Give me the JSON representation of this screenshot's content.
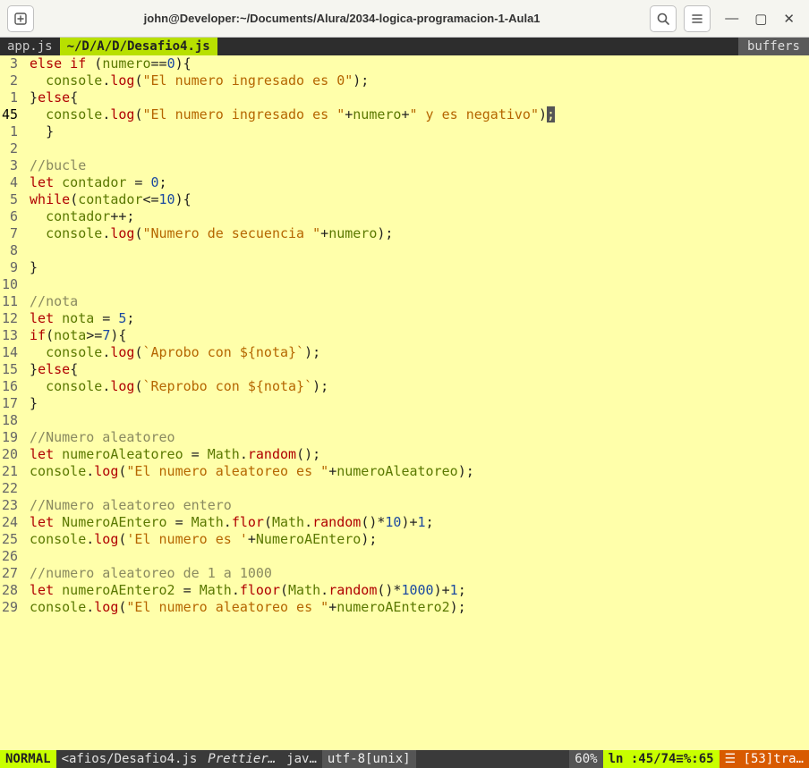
{
  "titlebar": {
    "title": "john@Developer:~/Documents/Alura/2034-logica-programacion-1-Aula1"
  },
  "tabbar": {
    "tabs": [
      {
        "label": "app.js",
        "active": false
      },
      {
        "label": "~/D/A/D/Desafio4.js",
        "active": true
      }
    ],
    "buffers_label": "buffers"
  },
  "code": {
    "lines": [
      {
        "g": "3",
        "cur": false,
        "tokens": [
          [
            "kw-red",
            "else if"
          ],
          [
            "punct",
            " ("
          ],
          [
            "var-gr",
            "numero"
          ],
          [
            "punct",
            "=="
          ],
          [
            "num-bl",
            "0"
          ],
          [
            "punct",
            "){"
          ]
        ]
      },
      {
        "g": "2",
        "cur": false,
        "tokens": [
          [
            "punct",
            "  "
          ],
          [
            "var-gr",
            "console"
          ],
          [
            "punct",
            "."
          ],
          [
            "fn-red",
            "log"
          ],
          [
            "punct",
            "("
          ],
          [
            "str-og",
            "\"El numero ingresado es 0\""
          ],
          [
            "punct",
            ");"
          ]
        ]
      },
      {
        "g": "1",
        "cur": false,
        "tokens": [
          [
            "punct",
            "}"
          ],
          [
            "kw-red",
            "else"
          ],
          [
            "punct",
            "{"
          ]
        ]
      },
      {
        "g": "45",
        "cur": true,
        "tokens": [
          [
            "punct",
            "  "
          ],
          [
            "var-gr",
            "console"
          ],
          [
            "punct",
            "."
          ],
          [
            "fn-red",
            "log"
          ],
          [
            "punct",
            "("
          ],
          [
            "str-og",
            "\"El numero ingresado es \""
          ],
          [
            "punct",
            "+"
          ],
          [
            "var-gr",
            "numero"
          ],
          [
            "punct",
            "+"
          ],
          [
            "str-og",
            "\" y es negativo\""
          ],
          [
            "punct",
            ")"
          ],
          [
            "cursor",
            ";"
          ]
        ]
      },
      {
        "g": "1",
        "cur": false,
        "tokens": [
          [
            "punct",
            "  }"
          ]
        ]
      },
      {
        "g": "2",
        "cur": false,
        "tokens": []
      },
      {
        "g": "3",
        "cur": false,
        "tokens": [
          [
            "cmt-gr",
            "//bucle "
          ]
        ]
      },
      {
        "g": "4",
        "cur": false,
        "tokens": [
          [
            "kw-red",
            "let"
          ],
          [
            "punct",
            " "
          ],
          [
            "var-gr",
            "contador"
          ],
          [
            "punct",
            " = "
          ],
          [
            "num-bl",
            "0"
          ],
          [
            "punct",
            ";"
          ]
        ]
      },
      {
        "g": "5",
        "cur": false,
        "tokens": [
          [
            "kw-red",
            "while"
          ],
          [
            "punct",
            "("
          ],
          [
            "var-gr",
            "contador"
          ],
          [
            "punct",
            "<="
          ],
          [
            "num-bl",
            "10"
          ],
          [
            "punct",
            "){"
          ]
        ]
      },
      {
        "g": "6",
        "cur": false,
        "tokens": [
          [
            "punct",
            "  "
          ],
          [
            "var-gr",
            "contador"
          ],
          [
            "punct",
            "++;"
          ]
        ]
      },
      {
        "g": "7",
        "cur": false,
        "tokens": [
          [
            "punct",
            "  "
          ],
          [
            "var-gr",
            "console"
          ],
          [
            "punct",
            "."
          ],
          [
            "fn-red",
            "log"
          ],
          [
            "punct",
            "("
          ],
          [
            "str-og",
            "\"Numero de secuencia \""
          ],
          [
            "punct",
            "+"
          ],
          [
            "var-gr",
            "numero"
          ],
          [
            "punct",
            ");"
          ]
        ]
      },
      {
        "g": "8",
        "cur": false,
        "tokens": []
      },
      {
        "g": "9",
        "cur": false,
        "tokens": [
          [
            "punct",
            "}"
          ]
        ]
      },
      {
        "g": "10",
        "cur": false,
        "tokens": []
      },
      {
        "g": "11",
        "cur": false,
        "tokens": [
          [
            "cmt-gr",
            "//nota"
          ]
        ]
      },
      {
        "g": "12",
        "cur": false,
        "tokens": [
          [
            "kw-red",
            "let"
          ],
          [
            "punct",
            " "
          ],
          [
            "var-gr",
            "nota"
          ],
          [
            "punct",
            " = "
          ],
          [
            "num-bl",
            "5"
          ],
          [
            "punct",
            ";"
          ]
        ]
      },
      {
        "g": "13",
        "cur": false,
        "tokens": [
          [
            "kw-red",
            "if"
          ],
          [
            "punct",
            "("
          ],
          [
            "var-gr",
            "nota"
          ],
          [
            "punct",
            ">="
          ],
          [
            "num-bl",
            "7"
          ],
          [
            "punct",
            "){"
          ]
        ]
      },
      {
        "g": "14",
        "cur": false,
        "tokens": [
          [
            "punct",
            "  "
          ],
          [
            "var-gr",
            "console"
          ],
          [
            "punct",
            "."
          ],
          [
            "fn-red",
            "log"
          ],
          [
            "punct",
            "("
          ],
          [
            "str-og",
            "`Aprobo con ${nota}`"
          ],
          [
            "punct",
            ");"
          ]
        ]
      },
      {
        "g": "15",
        "cur": false,
        "tokens": [
          [
            "punct",
            "}"
          ],
          [
            "kw-red",
            "else"
          ],
          [
            "punct",
            "{"
          ]
        ]
      },
      {
        "g": "16",
        "cur": false,
        "tokens": [
          [
            "punct",
            "  "
          ],
          [
            "var-gr",
            "console"
          ],
          [
            "punct",
            "."
          ],
          [
            "fn-red",
            "log"
          ],
          [
            "punct",
            "("
          ],
          [
            "str-og",
            "`Reprobo con ${nota}`"
          ],
          [
            "punct",
            ");"
          ]
        ]
      },
      {
        "g": "17",
        "cur": false,
        "tokens": [
          [
            "punct",
            "}"
          ]
        ]
      },
      {
        "g": "18",
        "cur": false,
        "tokens": []
      },
      {
        "g": "19",
        "cur": false,
        "tokens": [
          [
            "cmt-gr",
            "//Numero aleatoreo"
          ]
        ]
      },
      {
        "g": "20",
        "cur": false,
        "tokens": [
          [
            "kw-red",
            "let"
          ],
          [
            "punct",
            " "
          ],
          [
            "var-gr",
            "numeroAleatoreo"
          ],
          [
            "punct",
            " = "
          ],
          [
            "var-gr",
            "Math"
          ],
          [
            "punct",
            "."
          ],
          [
            "fn-red",
            "random"
          ],
          [
            "punct",
            "();"
          ]
        ]
      },
      {
        "g": "21",
        "cur": false,
        "tokens": [
          [
            "var-gr",
            "console"
          ],
          [
            "punct",
            "."
          ],
          [
            "fn-red",
            "log"
          ],
          [
            "punct",
            "("
          ],
          [
            "str-og",
            "\"El numero aleatoreo es \""
          ],
          [
            "punct",
            "+"
          ],
          [
            "var-gr",
            "numeroAleatoreo"
          ],
          [
            "punct",
            ");"
          ]
        ]
      },
      {
        "g": "22",
        "cur": false,
        "tokens": []
      },
      {
        "g": "23",
        "cur": false,
        "tokens": [
          [
            "cmt-gr",
            "//Numero aleatoreo entero"
          ]
        ]
      },
      {
        "g": "24",
        "cur": false,
        "tokens": [
          [
            "kw-red",
            "let"
          ],
          [
            "punct",
            " "
          ],
          [
            "var-gr",
            "NumeroAEntero"
          ],
          [
            "punct",
            " = "
          ],
          [
            "var-gr",
            "Math"
          ],
          [
            "punct",
            "."
          ],
          [
            "fn-red",
            "flor"
          ],
          [
            "punct",
            "("
          ],
          [
            "var-gr",
            "Math"
          ],
          [
            "punct",
            "."
          ],
          [
            "fn-red",
            "random"
          ],
          [
            "punct",
            "()*"
          ],
          [
            "num-bl",
            "10"
          ],
          [
            "punct",
            ")+"
          ],
          [
            "num-bl",
            "1"
          ],
          [
            "punct",
            ";"
          ]
        ]
      },
      {
        "g": "25",
        "cur": false,
        "tokens": [
          [
            "var-gr",
            "console"
          ],
          [
            "punct",
            "."
          ],
          [
            "fn-red",
            "log"
          ],
          [
            "punct",
            "("
          ],
          [
            "str-og",
            "'El numero es '"
          ],
          [
            "punct",
            "+"
          ],
          [
            "var-gr",
            "NumeroAEntero"
          ],
          [
            "punct",
            ");"
          ]
        ]
      },
      {
        "g": "26",
        "cur": false,
        "tokens": []
      },
      {
        "g": "27",
        "cur": false,
        "tokens": [
          [
            "cmt-gr",
            "//numero aleatoreo de 1 a 1000"
          ]
        ]
      },
      {
        "g": "28",
        "cur": false,
        "tokens": [
          [
            "kw-red",
            "let"
          ],
          [
            "punct",
            " "
          ],
          [
            "var-gr",
            "numeroAEntero2"
          ],
          [
            "punct",
            " = "
          ],
          [
            "var-gr",
            "Math"
          ],
          [
            "punct",
            "."
          ],
          [
            "fn-red",
            "floor"
          ],
          [
            "punct",
            "("
          ],
          [
            "var-gr",
            "Math"
          ],
          [
            "punct",
            "."
          ],
          [
            "fn-red",
            "random"
          ],
          [
            "punct",
            "()*"
          ],
          [
            "num-bl",
            "1000"
          ],
          [
            "punct",
            ")+"
          ],
          [
            "num-bl",
            "1"
          ],
          [
            "punct",
            ";"
          ]
        ]
      },
      {
        "g": "29",
        "cur": false,
        "tokens": [
          [
            "var-gr",
            "console"
          ],
          [
            "punct",
            "."
          ],
          [
            "fn-red",
            "log"
          ],
          [
            "punct",
            "("
          ],
          [
            "str-og",
            "\"El numero aleatoreo es \""
          ],
          [
            "punct",
            "+"
          ],
          [
            "var-gr",
            "numeroAEntero2"
          ],
          [
            "punct",
            ");"
          ]
        ]
      }
    ]
  },
  "statusbar": {
    "mode": " NORMAL ",
    "file": "<afios/Desafio4.js",
    "prettier": "Prettier…",
    "lang": "jav…",
    "enc": "utf-8[unix]",
    "pct": "60%",
    "pos": "ln :45/74≡%:65",
    "trail": "☰ [53]tra…"
  }
}
